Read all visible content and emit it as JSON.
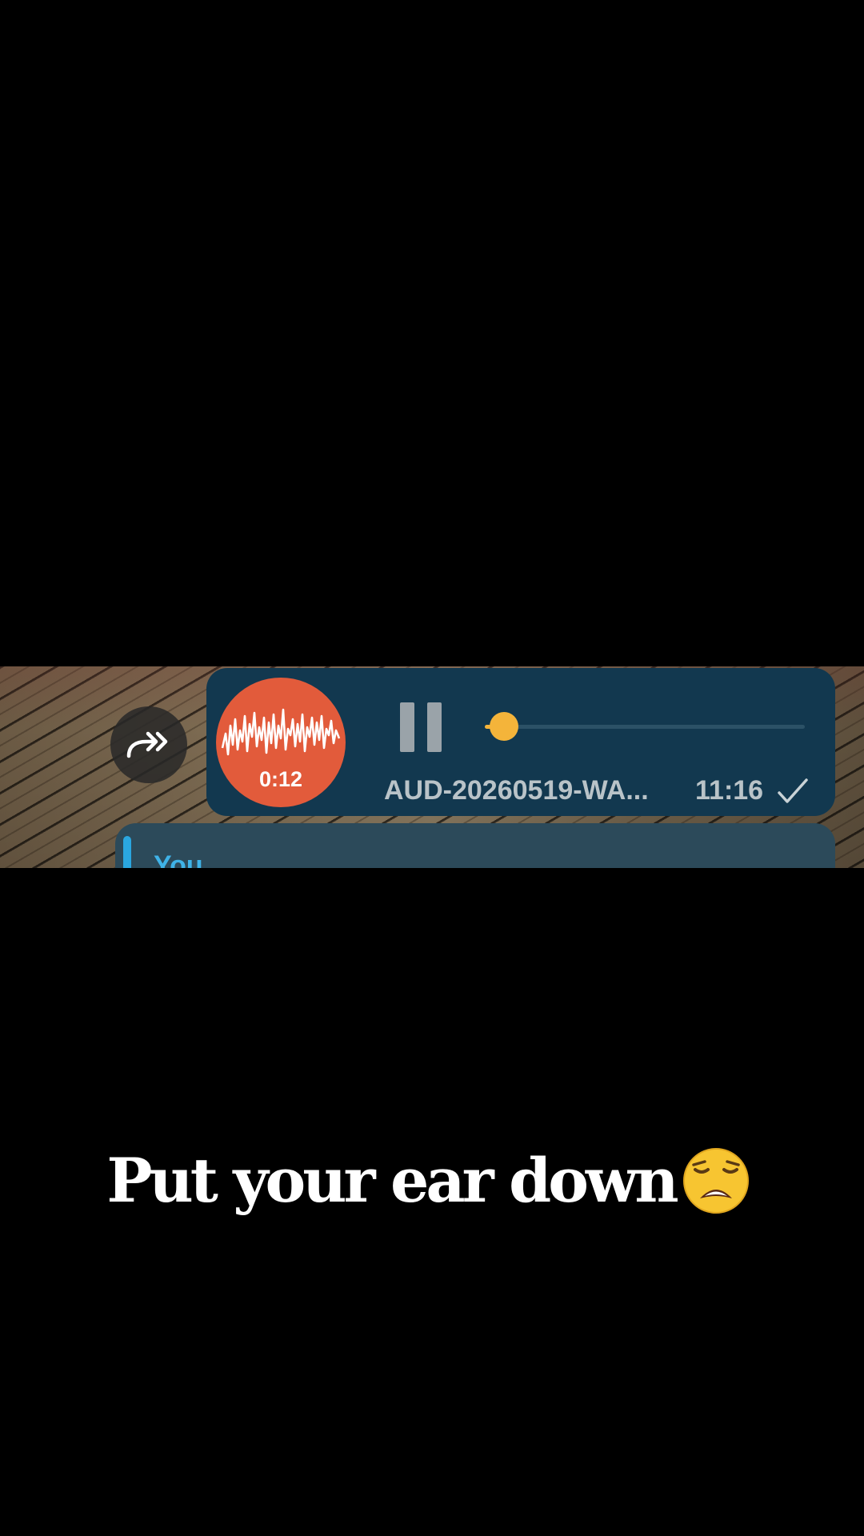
{
  "message": {
    "audio": {
      "duration": "0:12",
      "file_name": "AUD-20260519-WA...",
      "progress_fraction": 0.06,
      "icon": "waveform-icon",
      "state": "playing"
    },
    "time": "11:16",
    "status_icon": "check-icon",
    "forward_icon": "forward-icon"
  },
  "reply": {
    "sender": "You"
  },
  "caption": {
    "text": "Put your ear down",
    "emoji": "weary-face-emoji"
  },
  "colors": {
    "bubble": "#12384f",
    "audio_circle": "#e25b3b",
    "progress_accent": "#f4b43a",
    "reply_accent": "#2aa7e0"
  }
}
